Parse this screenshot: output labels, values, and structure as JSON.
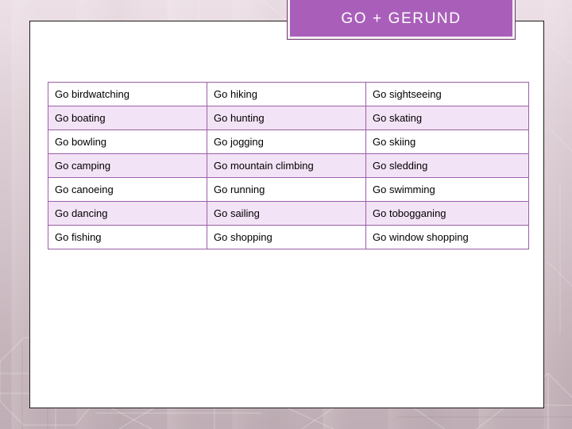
{
  "slide": {
    "title": "GO + GERUND",
    "accent_color": "#a95fba",
    "banner_border_color": "#f6eef7",
    "banner_outline_color": "#6f3a6b",
    "panel_background": "#ffffff",
    "background_color": "#c5b3b9",
    "table_border_color": "#9b5fa8",
    "row_alt_color": "#f3e3f6",
    "text_color": "#000000"
  },
  "table": {
    "rows": [
      [
        "Go birdwatching",
        "Go hiking",
        "Go sightseeing"
      ],
      [
        "Go boating",
        "Go hunting",
        "Go skating"
      ],
      [
        "Go bowling",
        "Go jogging",
        "Go skiing"
      ],
      [
        "Go camping",
        "Go mountain climbing",
        "Go sledding"
      ],
      [
        "Go canoeing",
        "Go running",
        "Go swimming"
      ],
      [
        "Go dancing",
        "Go sailing",
        "Go tobogganing"
      ],
      [
        "Go fishing",
        "Go shopping",
        "Go window shopping"
      ]
    ]
  }
}
